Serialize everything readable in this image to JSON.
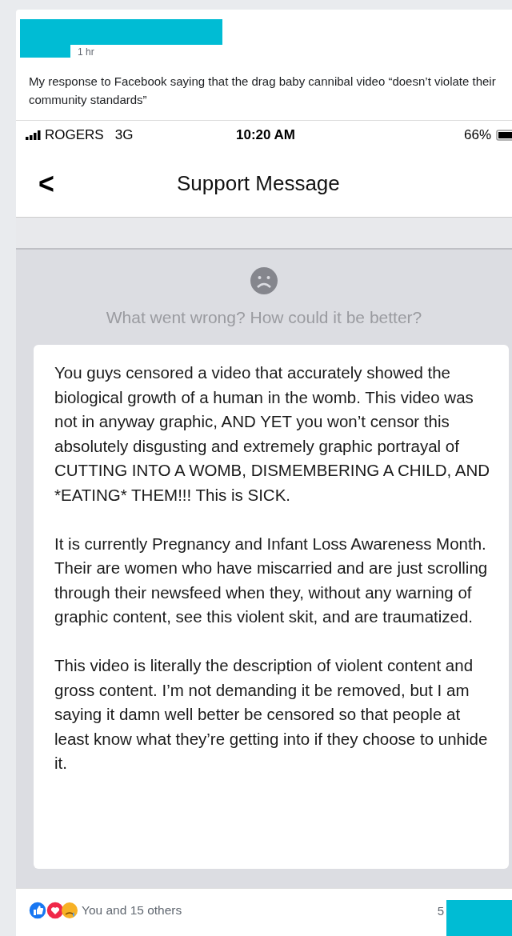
{
  "post": {
    "time": "1 hr",
    "text": "My response to Facebook saying that the drag baby cannibal video “doesn’t violate their community standards”"
  },
  "status_bar": {
    "carrier": "ROGERS",
    "network": "3G",
    "time": "10:20 AM",
    "battery": "66%"
  },
  "nav": {
    "back": "<",
    "title": "Support Message"
  },
  "feedback": {
    "prompt": "What went wrong? How could it be better?",
    "paragraphs": [
      "You guys censored a video that accurately showed the biological growth of a human in the womb. This video was not in anyway graphic, AND YET you won’t censor this absolutely disgusting and extremely graphic portrayal of CUTTING INTO A WOMB, DISMEMBERING A CHILD, AND *EATING* THEM!!! This is SICK.",
      "It is currently Pregnancy and Infant Loss Awareness Month. Their are women who have miscarried and are just scrolling through their newsfeed when they, without any warning of graphic content, see this violent skit, and are traumatized.",
      "This video is literally the description of violent content and gross content. I’m not demanding it be removed, but I am saying it damn well better be censored so that people at least know what they’re getting into if they choose to unhide it."
    ]
  },
  "reactions": {
    "summary": "You and 15 others",
    "count": "5"
  }
}
